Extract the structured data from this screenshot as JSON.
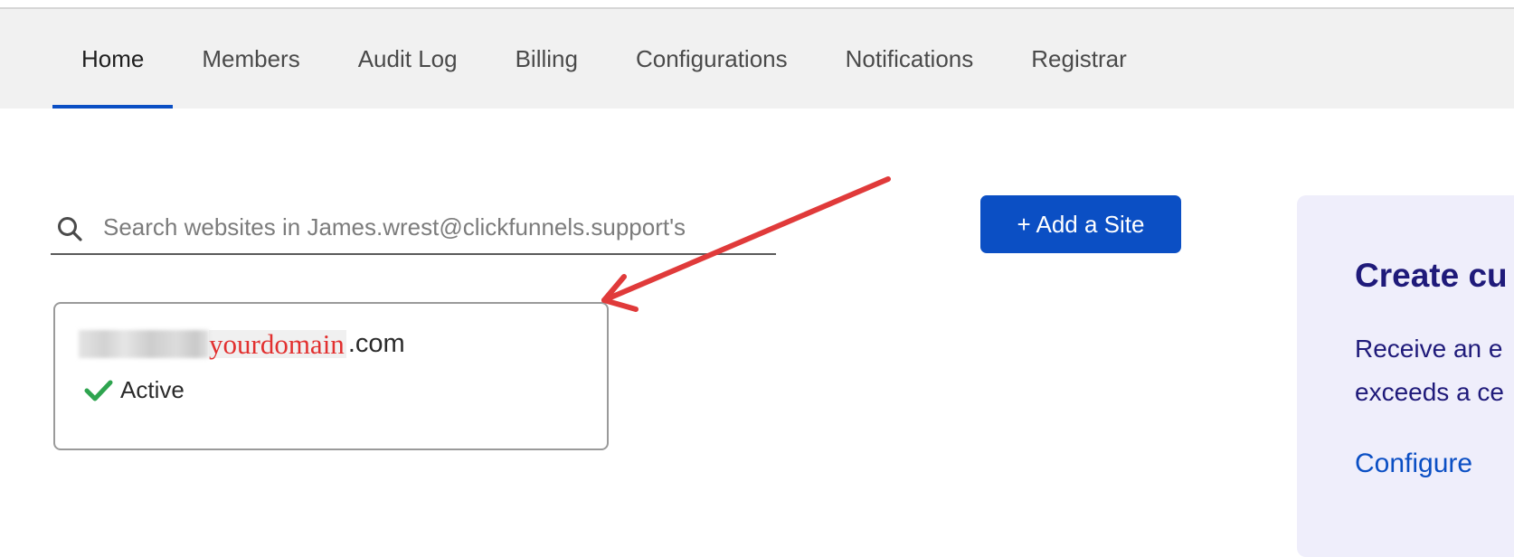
{
  "nav": {
    "tabs": [
      {
        "label": "Home",
        "active": true
      },
      {
        "label": "Members",
        "active": false
      },
      {
        "label": "Audit Log",
        "active": false
      },
      {
        "label": "Billing",
        "active": false
      },
      {
        "label": "Configurations",
        "active": false
      },
      {
        "label": "Notifications",
        "active": false
      },
      {
        "label": "Registrar",
        "active": false
      }
    ]
  },
  "search": {
    "placeholder": "Search websites in James.wrest@clickfunnels.support's",
    "value": "",
    "icon": "search-icon"
  },
  "add_site_button": {
    "label": "+ Add a Site"
  },
  "sites": [
    {
      "domain_highlight": "yourdomain",
      "domain_tld": ".com",
      "status": "Active",
      "status_icon": "check-icon"
    }
  ],
  "promo": {
    "title": "Create cu",
    "body_lines": [
      "Receive an e",
      "exceeds a ce"
    ],
    "link": "Configure"
  },
  "annotation": {
    "type": "arrow",
    "color": "#e03a3a"
  },
  "colors": {
    "accent": "#0b4fc4",
    "active_status": "#2ea44f",
    "promo_bg": "#efeefb",
    "promo_text": "#1f1a7a"
  }
}
